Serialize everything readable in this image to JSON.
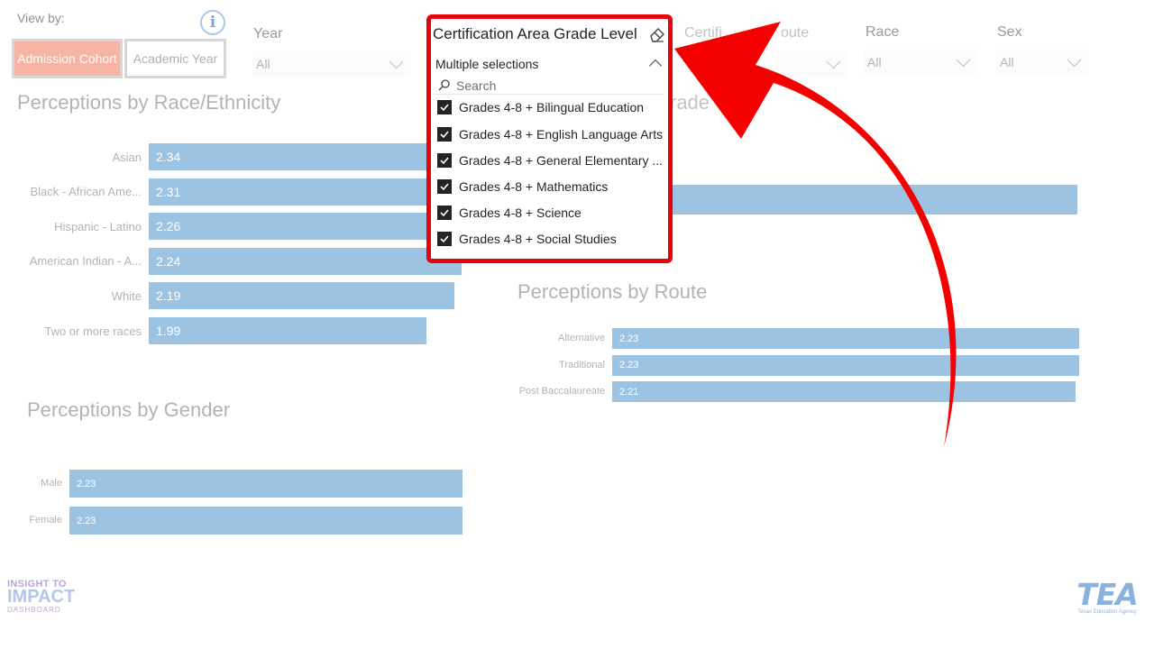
{
  "view_by": {
    "label": "View by:",
    "info_glyph": "i",
    "buttons": [
      {
        "label": "Admission Cohort",
        "active": true
      },
      {
        "label": "Academic Year",
        "active": false
      }
    ]
  },
  "filters": [
    {
      "label": "Year",
      "value": "All"
    },
    {
      "label": "Race",
      "value": "All"
    },
    {
      "label": "Sex",
      "value": "All"
    }
  ],
  "covered_texts": {
    "cert_route_fragment": "Certifi",
    "cert_route_fragment_end": "oute",
    "grade_fragment": "rade"
  },
  "dropdown": {
    "title": "Certification Area Grade Level",
    "selection_text": "Multiple selections",
    "search_placeholder": "Search",
    "options": [
      {
        "label": "Grades 4-8 + Bilingual Education",
        "checked": true
      },
      {
        "label": "Grades 4-8 + English Language Arts",
        "checked": true
      },
      {
        "label": "Grades 4-8 + General Elementary ...",
        "checked": true
      },
      {
        "label": "Grades 4-8 + Mathematics",
        "checked": true
      },
      {
        "label": "Grades 4-8 + Science",
        "checked": true
      },
      {
        "label": "Grades 4-8 + Social Studies",
        "checked": true
      }
    ],
    "border_color": "#e5040b"
  },
  "sections": {
    "race_title": "Perceptions by Race/Ethnicity",
    "gender_title": "Perceptions by Gender",
    "route_title": "Perceptions by Route"
  },
  "chart_data": [
    {
      "type": "bar",
      "title": "Perceptions by Race/Ethnicity",
      "orientation": "horizontal",
      "categories": [
        "Asian",
        "Black - African Ame...",
        "Hispanic - Latino",
        "American Indian - A...",
        "White",
        "Two or more races"
      ],
      "values": [
        2.34,
        2.31,
        2.26,
        2.24,
        2.19,
        1.99
      ],
      "labels": [
        "2.34",
        "2.31",
        "2.26",
        "2.24",
        "2.19",
        "1.99"
      ],
      "color": "#9dc3e3"
    },
    {
      "type": "bar",
      "title": "Perceptions by Gender",
      "orientation": "horizontal",
      "categories": [
        "Male",
        "Female"
      ],
      "values": [
        2.23,
        2.23
      ],
      "labels": [
        "2.23",
        "2.23"
      ],
      "color": "#9dc3e3"
    },
    {
      "type": "bar",
      "title": "Perceptions by Route",
      "orientation": "horizontal",
      "categories": [
        "Alternative",
        "Traditional",
        "Post Baccalaureate"
      ],
      "values": [
        2.23,
        2.23,
        2.21
      ],
      "labels": [
        "2.23",
        "2.23",
        "2.21"
      ],
      "color": "#9dc3e3"
    }
  ],
  "annotation": {
    "arrow_color": "#f50000"
  },
  "logos": {
    "left_line1": "INSIGHT TO",
    "left_line2": "IMPACT",
    "left_line3": "DASHBOARD",
    "right_mark": "TEA",
    "right_sub": "Texas Education Agency"
  }
}
